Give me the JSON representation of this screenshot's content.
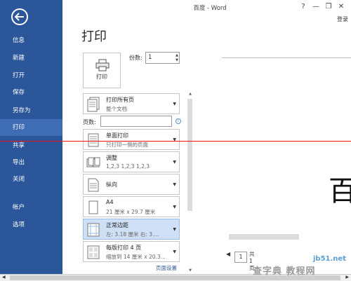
{
  "window": {
    "title": "百度 - Word",
    "help": "?",
    "minimize": "—",
    "restore": "❐",
    "close": "✕",
    "login": "登录"
  },
  "sidebar": {
    "items": [
      {
        "label": "信息"
      },
      {
        "label": "新建"
      },
      {
        "label": "打开"
      },
      {
        "label": "保存"
      },
      {
        "label": "另存为"
      },
      {
        "label": "打印"
      },
      {
        "label": "共享"
      },
      {
        "label": "导出"
      },
      {
        "label": "关闭"
      },
      {
        "label": "帐户"
      },
      {
        "label": "选项"
      }
    ]
  },
  "page_title": "打印",
  "print": {
    "button_label": "打印",
    "copies_label": "份数:",
    "copies_value": "1"
  },
  "settings": {
    "pages_label": "页数:",
    "items": [
      {
        "title": "打印所有页",
        "sub": "整个文档"
      },
      {
        "title": "单面打印",
        "sub": "只打印一侧的页面"
      },
      {
        "title": "调整",
        "sub": "1,2,3    1,2,3    1,2,3"
      },
      {
        "title": "纵向",
        "sub": ""
      },
      {
        "title": "A4",
        "sub": "21 厘米 x 29.7 厘米"
      },
      {
        "title": "正常边距",
        "sub": "左: 3.18 厘米   右: 3...."
      },
      {
        "title": "每版打印 4 页",
        "sub": "缩放到 14 厘米 x 20.3..."
      }
    ],
    "page_setup_link": "页面设置"
  },
  "preview": {
    "big_char": "百",
    "page_num": "1",
    "total_label_1": "共",
    "total_label_2": "1",
    "total_label_3": "页"
  },
  "watermark": {
    "line1": "jb51.net",
    "line2": "查字典 教程网"
  }
}
